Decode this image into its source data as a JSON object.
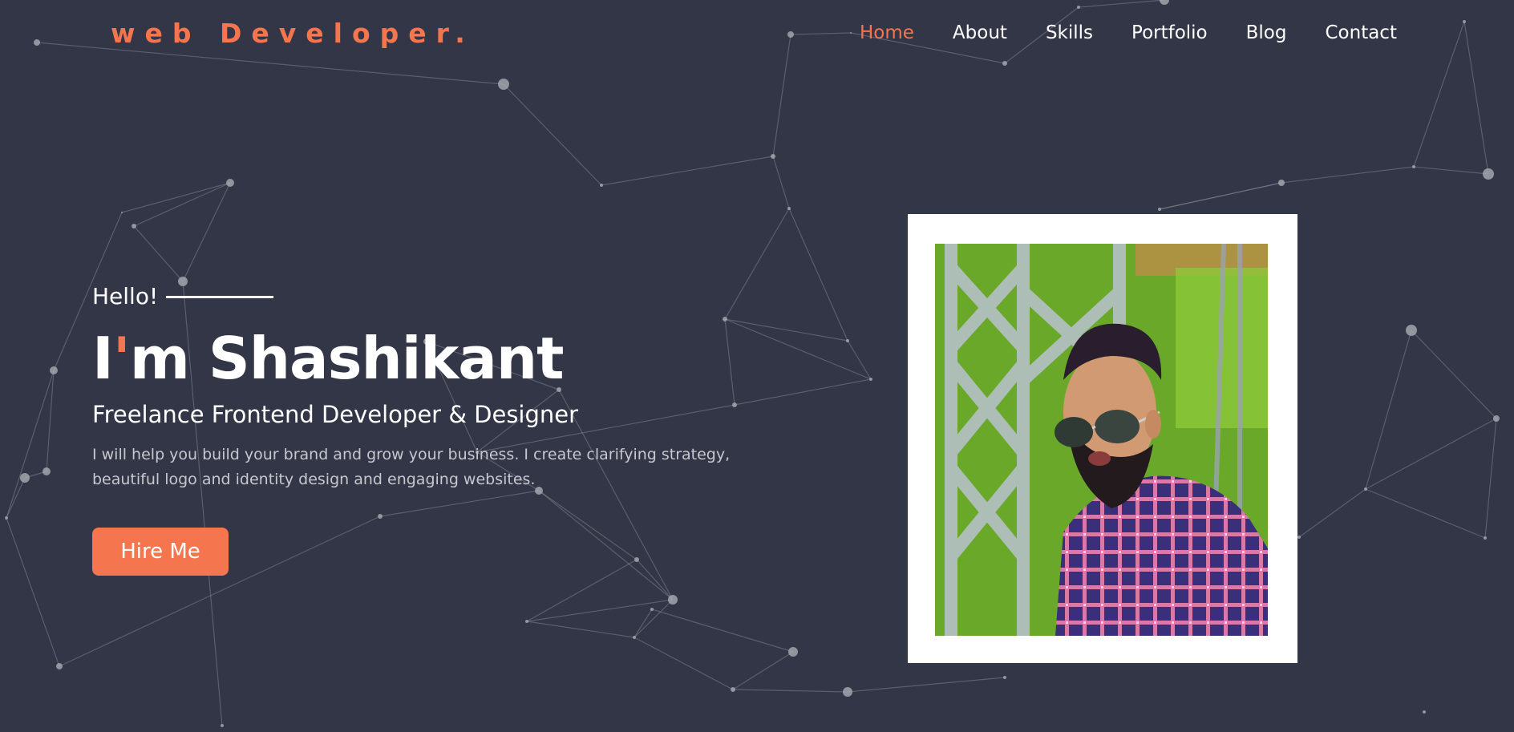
{
  "header": {
    "logo": "web Developer.",
    "nav": [
      {
        "label": "Home",
        "active": true
      },
      {
        "label": "About",
        "active": false
      },
      {
        "label": "Skills",
        "active": false
      },
      {
        "label": "Portfolio",
        "active": false
      },
      {
        "label": "Blog",
        "active": false
      },
      {
        "label": "Contact",
        "active": false
      }
    ]
  },
  "hero": {
    "greeting": "Hello!",
    "name_prefix_i": "I",
    "name_apostrophe": "'",
    "name_rest": "m Shashikant",
    "subtitle": "Freelance Frontend Developer & Designer",
    "description": "I will help you build your brand and grow your business. I create clarifying strategy, beautiful logo and identity design and engaging websites.",
    "cta_label": "Hire Me"
  },
  "colors": {
    "background": "#333646",
    "accent": "#f5754e",
    "text": "#ffffff",
    "muted_text": "#c7c8cf",
    "frame": "#ffffff"
  },
  "icons": {
    "background": "particle-network-icon",
    "profile": "profile-photo"
  }
}
